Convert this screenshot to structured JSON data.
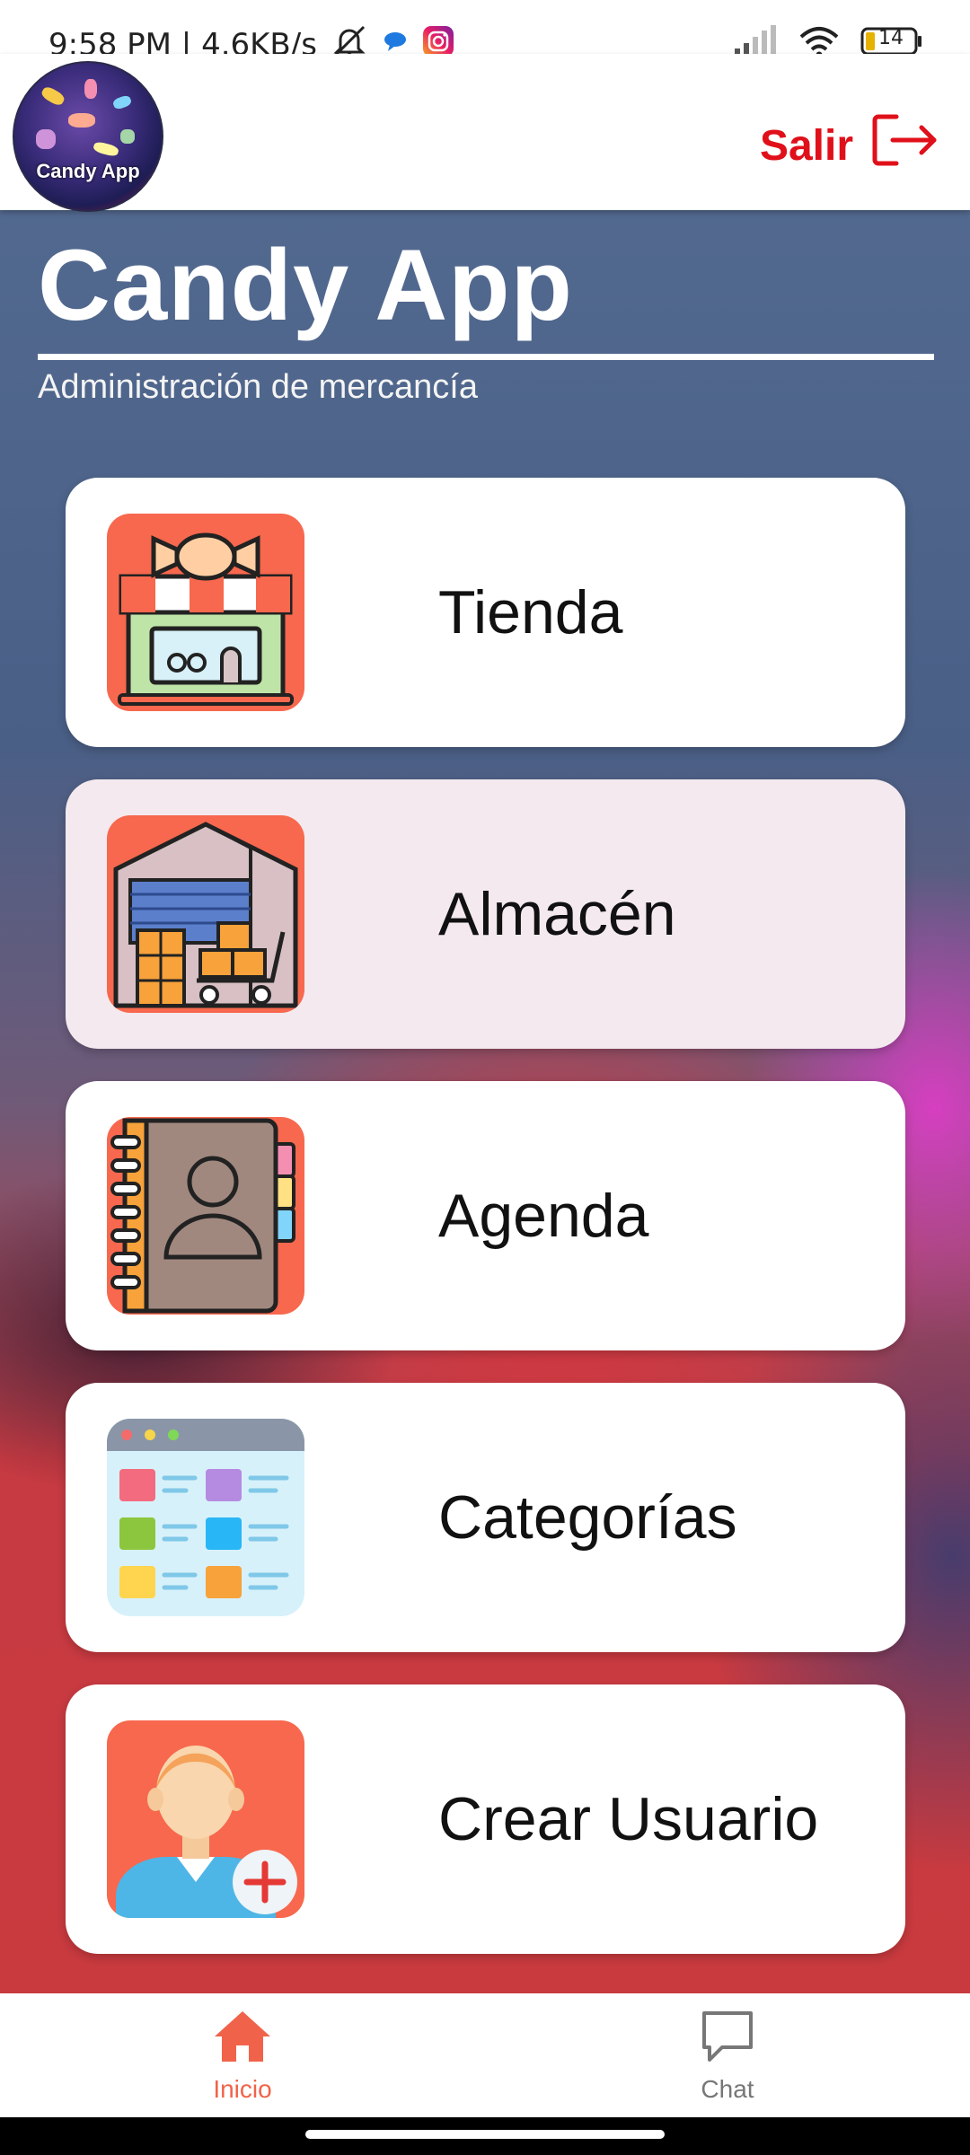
{
  "status_bar": {
    "time_speed": "9:58 PM | 4.6KB/s",
    "battery": "14",
    "icons": [
      "mute-bell-icon",
      "chat-bubble-icon",
      "instagram-icon",
      "signal-icon",
      "wifi-icon",
      "battery-icon"
    ]
  },
  "header": {
    "logo_text": "Candy App",
    "logout_label": "Salir",
    "logout_icon": "logout-icon",
    "accent_color": "#e0101a"
  },
  "main": {
    "title": "Candy App",
    "subtitle": "Administración de mercancía"
  },
  "menu": [
    {
      "label": "Tienda",
      "icon": "store-icon"
    },
    {
      "label": "Almacén",
      "icon": "warehouse-icon"
    },
    {
      "label": "Agenda",
      "icon": "address-book-icon"
    },
    {
      "label": "Categorías",
      "icon": "categories-icon"
    },
    {
      "label": "Crear Usuario",
      "icon": "add-user-icon"
    }
  ],
  "bottom_nav": {
    "items": [
      {
        "label": "Inicio",
        "icon": "home-icon",
        "active": true
      },
      {
        "label": "Chat",
        "icon": "chat-icon",
        "active": false
      }
    ],
    "active_color": "#f0634a",
    "inactive_color": "#777777"
  }
}
